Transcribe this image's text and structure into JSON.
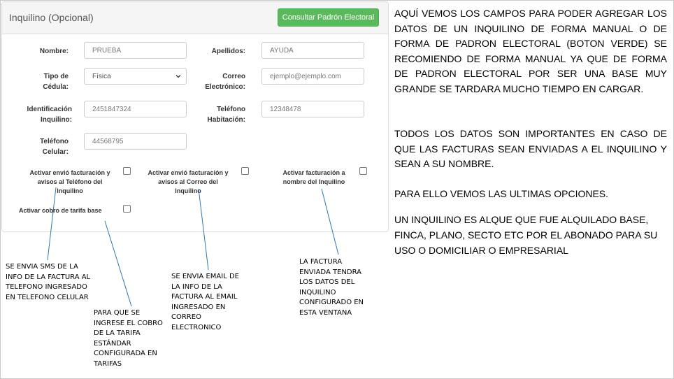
{
  "panel": {
    "title": "Inquilino (Opcional)",
    "consult_button": "Consultar Padrón Electoral"
  },
  "form": {
    "nombre_label": "Nombre:",
    "nombre_value": "PRUEBA",
    "apellidos_label": "Apellidos:",
    "apellidos_value": "AYUDA",
    "tipo_cedula_label_1": "Tipo de",
    "tipo_cedula_label_2": "Cédula:",
    "tipo_cedula_value": "Física",
    "correo_label_1": "Correo",
    "correo_label_2": "Electrónico:",
    "correo_placeholder": "ejemplo@ejemplo.com",
    "identificacion_label_1": "Identificación",
    "identificacion_label_2": "Inquilino:",
    "identificacion_value": "2451847324",
    "telefono_hab_label_1": "Teléfono",
    "telefono_hab_label_2": "Habitación:",
    "telefono_hab_value": "12348478",
    "telefono_cel_label_1": "Teléfono",
    "telefono_cel_label_2": "Celular:",
    "telefono_cel_value": "44568795"
  },
  "checkboxes": {
    "sms_1": "Activar envió facturación y",
    "sms_2": "avisos al Teléfono del",
    "sms_3": "Inquilino",
    "email_1": "Activar envió facturación y",
    "email_2": "avisos al Correo del",
    "email_3": "Inquilino",
    "nombre_1": "Activar facturación a",
    "nombre_2": "nombre del Inquilino",
    "tarifa": "Activar cobro de tarifa base"
  },
  "annotations": {
    "sms": [
      "SE ENVIA SMS DE LA",
      "INFO DE LA FACTURA AL",
      "TELEFONO INGRESADO",
      "EN TELEFONO CELULAR"
    ],
    "tarifa": [
      "PARA QUE SE",
      "INGRESE EL COBRO",
      "DE LA TARIFA",
      "ESTÁNDAR",
      "CONFIGURADA EN",
      "TARIFAS"
    ],
    "email": [
      "SE ENVIA EMAIL DE",
      "LA INFO DE LA",
      "FACTURA AL EMAIL",
      "INGRESADO EN",
      "CORREO",
      "ELECTRONICO"
    ],
    "nombre": [
      "LA FACTURA",
      "ENVIADA TENDRA",
      "LOS DATOS DEL",
      "INQUILINO",
      "CONFIGURADO EN",
      "ESTA VENTANA"
    ]
  },
  "explanation": {
    "p1": "AQUÍ VEMOS LOS CAMPOS PARA PODER AGREGAR LOS DATOS DE UN INQUILINO DE FORMA MANUAL O DE FORMA DE PADRON ELECTORAL (BOTON VERDE) SE RECOMIENDO DE FORMA MANUAL YA QUE DE FORMA DE PADRON ELECTORAL POR SER UNA BASE MUY GRANDE SE TARDARA MUCHO TIEMPO EN CARGAR.",
    "p2": "TODOS LOS DATOS SON IMPORTANTES EN CASO DE QUE LAS FACTURAS SEAN ENVIADAS A EL INQUILINO Y SEAN A SU NOMBRE.",
    "p3": "PARA ELLO VEMOS LAS ULTIMAS OPCIONES.",
    "p4": "UN INQUILINO ES ALQUE QUE FUE ALQUILADO BASE, FINCA, PLANO, SECTO ETC POR EL ABONADO PARA SU USO O DOMICILIAR O EMPRESARIAL"
  },
  "colors": {
    "button_green": "#5cb85c",
    "arrow_blue": "#2e75b6"
  }
}
